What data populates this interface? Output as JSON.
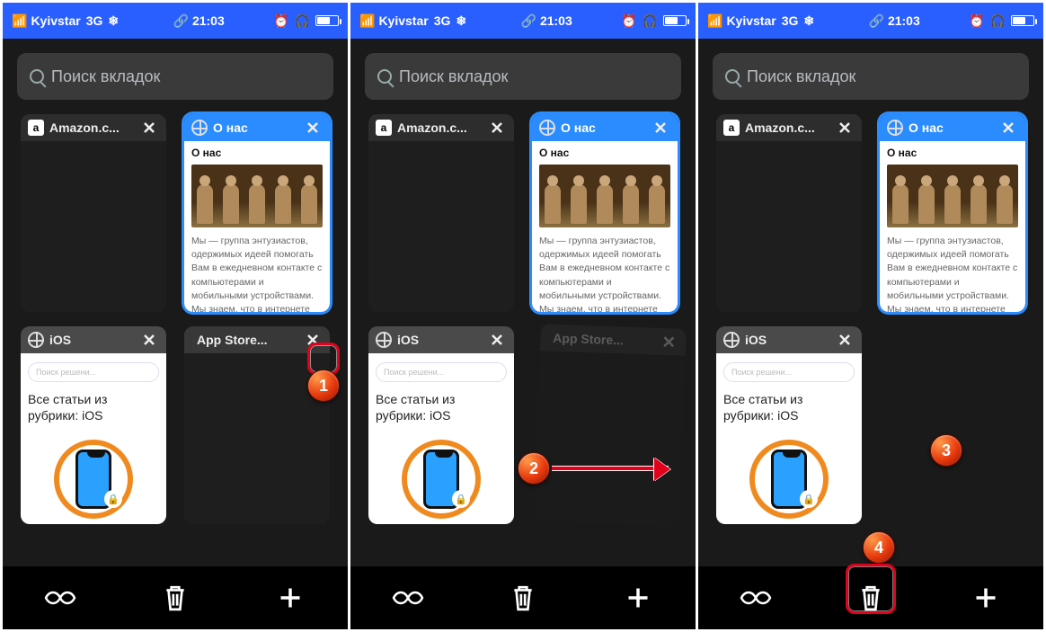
{
  "status": {
    "carrier": "Kyivstar",
    "network": "3G",
    "time": "21:03"
  },
  "search": {
    "placeholder": "Поиск вкладок"
  },
  "tabs": {
    "amazon": {
      "title": "Amazon.c..."
    },
    "about": {
      "title": "О нас",
      "heading": "О нас",
      "paragraph": "Мы — группа энтузиастов, одержимых идеей помогать Вам в ежедневном контакте с компьютерами и мобильными устройствами. Мы знаем, что в интернете уже полно"
    },
    "ios": {
      "title": "iOS",
      "search_placeholder": "Поиск решени...",
      "heading": "Все статьи из рубрики: iOS"
    },
    "appstore": {
      "title": "App Store..."
    }
  },
  "annotations": {
    "b1": "1",
    "b2": "2",
    "b3": "3",
    "b4": "4"
  }
}
